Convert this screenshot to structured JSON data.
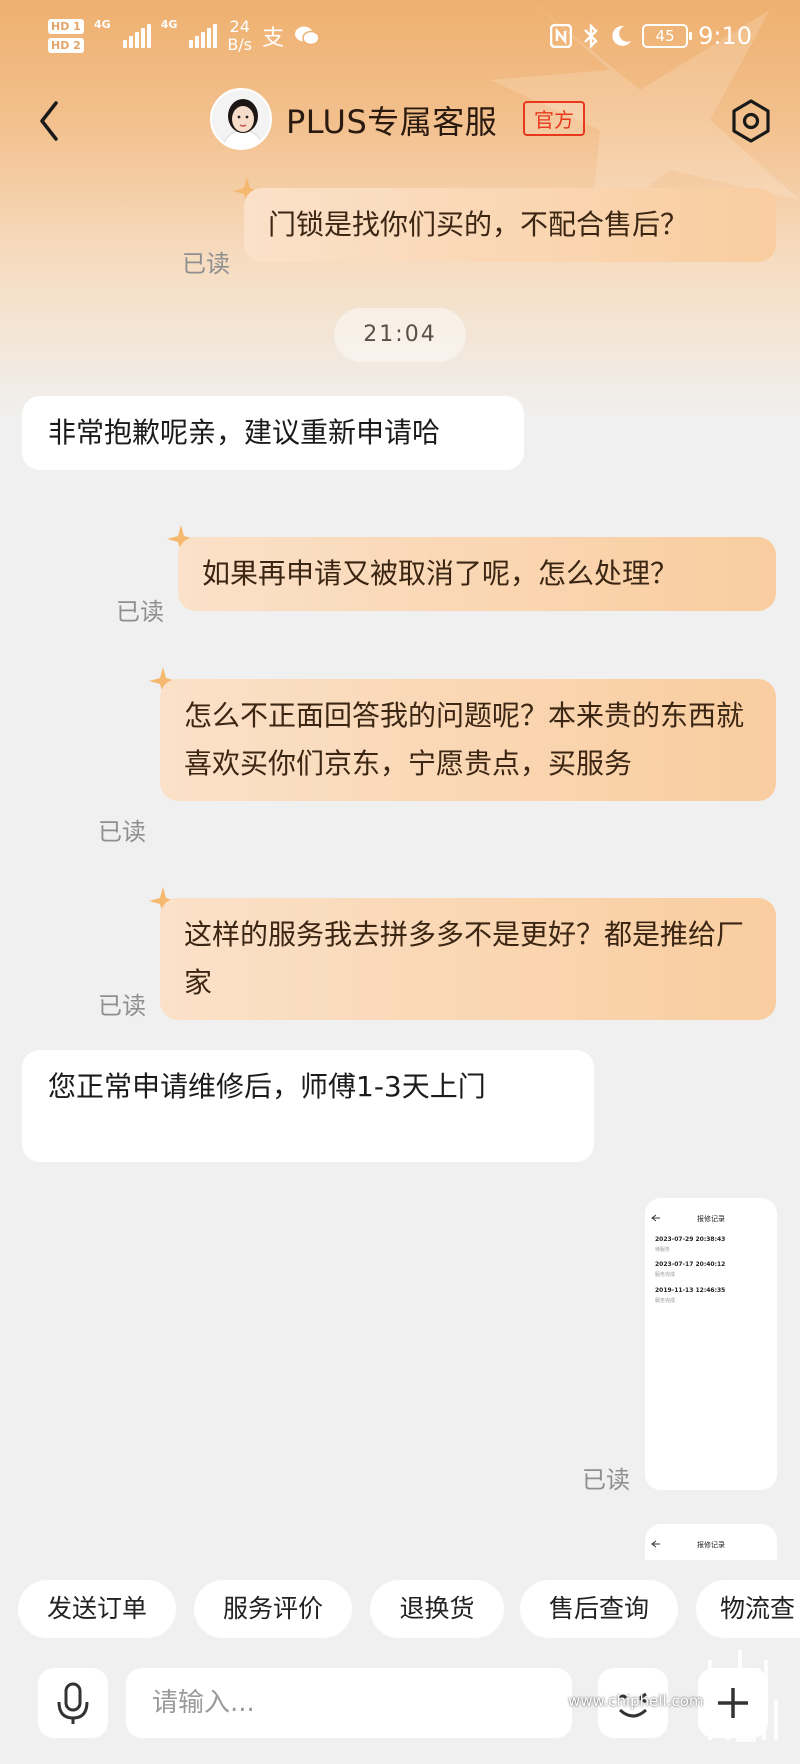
{
  "status_bar": {
    "hd1": "HD 1",
    "hd2": "HD 2",
    "net1": "4G",
    "net2": "4G",
    "speed_value": "24",
    "speed_unit": "B/s",
    "battery": "45",
    "time": "9:10"
  },
  "header": {
    "title": "PLUS专属客服",
    "badge": "官方"
  },
  "chat": {
    "read_label": "已读",
    "time_divider": "21:04",
    "messages": [
      {
        "dir": "out",
        "text": "门锁是找你们买的，不配合售后？"
      },
      {
        "dir": "in",
        "text": "非常抱歉呢亲，建议重新申请哈"
      },
      {
        "dir": "out",
        "text": "如果再申请又被取消了呢，怎么处理？"
      },
      {
        "dir": "out",
        "text": "怎么不正面回答我的问题呢？本来贵的东西就喜欢买你们京东，宁愿贵点，买服务"
      },
      {
        "dir": "out",
        "text": "这样的服务我去拼多多不是更好？都是推给厂家"
      },
      {
        "dir": "in",
        "text": "您正常申请维修后，师傅1-3天上门"
      }
    ],
    "image_message": {
      "title": "报修记录",
      "records": [
        {
          "date": "2023-07-29 20:38:43",
          "status": "待服务"
        },
        {
          "date": "2023-07-17 20:40:12",
          "status": "服务完成"
        },
        {
          "date": "2019-11-13 12:46:35",
          "status": "服务完成"
        }
      ]
    }
  },
  "quick_replies": [
    "发送订单",
    "服务评价",
    "退换货",
    "售后查询",
    "物流查"
  ],
  "input": {
    "placeholder": "请输入..."
  },
  "watermark": "www.chiphell.com",
  "colors": {
    "header_gradient_top": "#eeb06f",
    "outgoing_bubble": "#f9cd9f",
    "official_badge": "#e8391e",
    "chat_bg": "#f0f0f0"
  }
}
